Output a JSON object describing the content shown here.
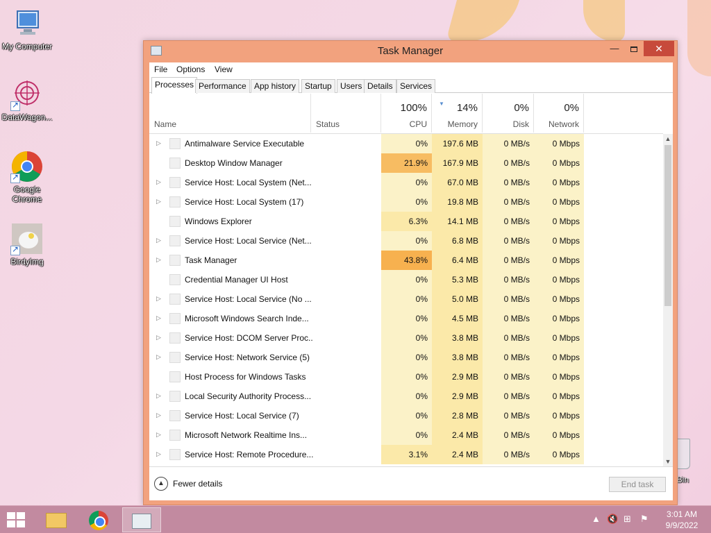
{
  "desktop": {
    "icons": [
      {
        "label": "My Computer"
      },
      {
        "label": "DataWagon..."
      },
      {
        "label": "Google Chrome"
      },
      {
        "label": "BirdyImg"
      }
    ],
    "recycle_bin_label": "le Bin"
  },
  "window": {
    "title": "Task Manager",
    "menu": [
      "File",
      "Options",
      "View"
    ],
    "tabs": [
      "Processes",
      "Performance",
      "App history",
      "Startup",
      "Users",
      "Details",
      "Services"
    ],
    "active_tab": "Processes"
  },
  "table": {
    "headers": {
      "name": "Name",
      "status": "Status",
      "cpu": {
        "label": "CPU",
        "percent": "100%"
      },
      "memory": {
        "label": "Memory",
        "percent": "14%"
      },
      "disk": {
        "label": "Disk",
        "percent": "0%"
      },
      "network": {
        "label": "Network",
        "percent": "0%"
      }
    },
    "rows": [
      {
        "name": "Antimalware Service Executable",
        "expandable": true,
        "cpu": "0%",
        "memory": "197.6 MB",
        "disk": "0 MB/s",
        "network": "0 Mbps"
      },
      {
        "name": "Desktop Window Manager",
        "expandable": false,
        "cpu": "21.9%",
        "memory": "167.9 MB",
        "disk": "0 MB/s",
        "network": "0 Mbps"
      },
      {
        "name": "Service Host: Local System (Net...",
        "expandable": true,
        "cpu": "0%",
        "memory": "67.0 MB",
        "disk": "0 MB/s",
        "network": "0 Mbps"
      },
      {
        "name": "Service Host: Local System (17)",
        "expandable": true,
        "cpu": "0%",
        "memory": "19.8 MB",
        "disk": "0 MB/s",
        "network": "0 Mbps"
      },
      {
        "name": "Windows Explorer",
        "expandable": false,
        "cpu": "6.3%",
        "memory": "14.1 MB",
        "disk": "0 MB/s",
        "network": "0 Mbps"
      },
      {
        "name": "Service Host: Local Service (Net...",
        "expandable": true,
        "cpu": "0%",
        "memory": "6.8 MB",
        "disk": "0 MB/s",
        "network": "0 Mbps"
      },
      {
        "name": "Task Manager",
        "expandable": true,
        "cpu": "43.8%",
        "memory": "6.4 MB",
        "disk": "0 MB/s",
        "network": "0 Mbps"
      },
      {
        "name": "Credential Manager UI Host",
        "expandable": false,
        "cpu": "0%",
        "memory": "5.3 MB",
        "disk": "0 MB/s",
        "network": "0 Mbps"
      },
      {
        "name": "Service Host: Local Service (No ...",
        "expandable": true,
        "cpu": "0%",
        "memory": "5.0 MB",
        "disk": "0 MB/s",
        "network": "0 Mbps"
      },
      {
        "name": "Microsoft Windows Search Inde...",
        "expandable": true,
        "cpu": "0%",
        "memory": "4.5 MB",
        "disk": "0 MB/s",
        "network": "0 Mbps"
      },
      {
        "name": "Service Host: DCOM Server Proc...",
        "expandable": true,
        "cpu": "0%",
        "memory": "3.8 MB",
        "disk": "0 MB/s",
        "network": "0 Mbps"
      },
      {
        "name": "Service Host: Network Service (5)",
        "expandable": true,
        "cpu": "0%",
        "memory": "3.8 MB",
        "disk": "0 MB/s",
        "network": "0 Mbps"
      },
      {
        "name": "Host Process for Windows Tasks",
        "expandable": false,
        "cpu": "0%",
        "memory": "2.9 MB",
        "disk": "0 MB/s",
        "network": "0 Mbps"
      },
      {
        "name": "Local Security Authority Process...",
        "expandable": true,
        "cpu": "0%",
        "memory": "2.9 MB",
        "disk": "0 MB/s",
        "network": "0 Mbps"
      },
      {
        "name": "Service Host: Local Service (7)",
        "expandable": true,
        "cpu": "0%",
        "memory": "2.8 MB",
        "disk": "0 MB/s",
        "network": "0 Mbps"
      },
      {
        "name": "Microsoft Network Realtime Ins...",
        "expandable": true,
        "cpu": "0%",
        "memory": "2.4 MB",
        "disk": "0 MB/s",
        "network": "0 Mbps"
      },
      {
        "name": "Service Host: Remote Procedure...",
        "expandable": true,
        "cpu": "3.1%",
        "memory": "2.4 MB",
        "disk": "0 MB/s",
        "network": "0 Mbps"
      }
    ]
  },
  "footer": {
    "fewer_details": "Fewer details",
    "end_task": "End task"
  },
  "taskbar": {
    "time": "3:01 AM",
    "date": "9/9/2022"
  },
  "icons": {
    "expander": "chevron-right-icon",
    "fewer": "chevron-up-circle-icon"
  }
}
